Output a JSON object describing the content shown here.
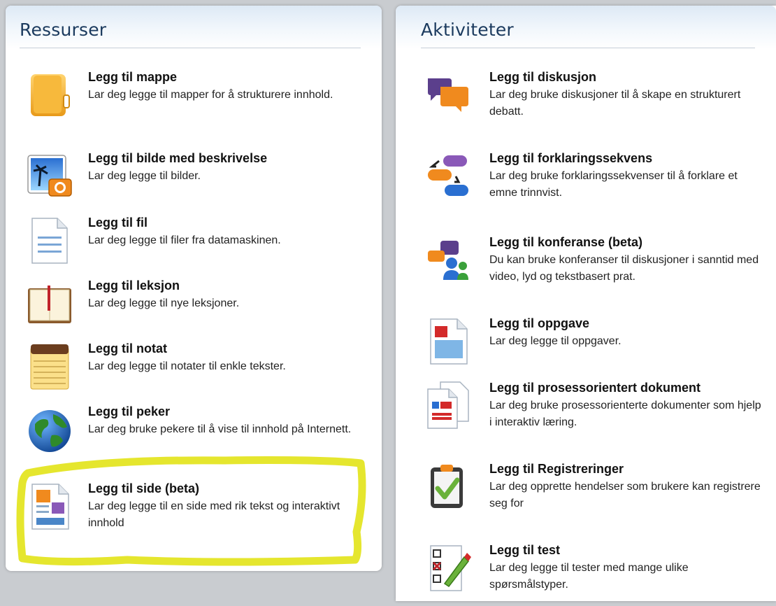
{
  "left": {
    "title": "Ressurser",
    "items": [
      {
        "title": "Legg til mappe",
        "desc": "Lar deg legge til mapper for å strukturere innhold.",
        "icon": "folder-icon"
      },
      {
        "title": "Legg til bilde med beskrivelse",
        "desc": "Lar deg legge til bilder.",
        "icon": "image-icon"
      },
      {
        "title": "Legg til fil",
        "desc": "Lar deg legge til filer fra datamaskinen.",
        "icon": "file-icon"
      },
      {
        "title": "Legg til leksjon",
        "desc": "Lar deg legge til nye leksjoner.",
        "icon": "book-icon"
      },
      {
        "title": "Legg til notat",
        "desc": "Lar deg legge til notater til enkle tekster.",
        "icon": "notepad-icon"
      },
      {
        "title": "Legg til peker",
        "desc": "Lar deg bruke pekere til å vise til innhold på Internett.",
        "icon": "globe-icon"
      },
      {
        "title": "Legg til side (beta)",
        "desc": "Lar deg legge til en side med rik tekst og interaktivt innhold",
        "icon": "page-icon"
      }
    ]
  },
  "right": {
    "title": "Aktiviteter",
    "items": [
      {
        "title": "Legg til diskusjon",
        "desc": "Lar deg bruke diskusjoner til å skape en strukturert debatt.",
        "icon": "discussion-icon"
      },
      {
        "title": "Legg til forklaringssekvens",
        "desc": "Lar deg bruke forklaringssekvenser til å forklare et emne trinnvist.",
        "icon": "sequence-icon"
      },
      {
        "title": "Legg til konferanse (beta)",
        "desc": "Du kan bruke konferanser til diskusjoner i sanntid med video, lyd og tekstbasert prat.",
        "icon": "conference-icon"
      },
      {
        "title": "Legg til oppgave",
        "desc": "Lar deg legge til oppgaver.",
        "icon": "assignment-icon"
      },
      {
        "title": "Legg til prosessorientert dokument",
        "desc": "Lar deg bruke prosessorienterte dokumenter som hjelp i interaktiv læring.",
        "icon": "documents-icon"
      },
      {
        "title": "Legg til Registreringer",
        "desc": "Lar deg opprette hendelser som brukere kan registrere seg for",
        "icon": "clipboard-check-icon"
      },
      {
        "title": "Legg til test",
        "desc": "Lar deg legge til tester med mange ulike spørsmålstyper.",
        "icon": "test-icon"
      }
    ]
  },
  "colors": {
    "header_text": "#1b3a5e",
    "highlight": "#e3e41c"
  }
}
